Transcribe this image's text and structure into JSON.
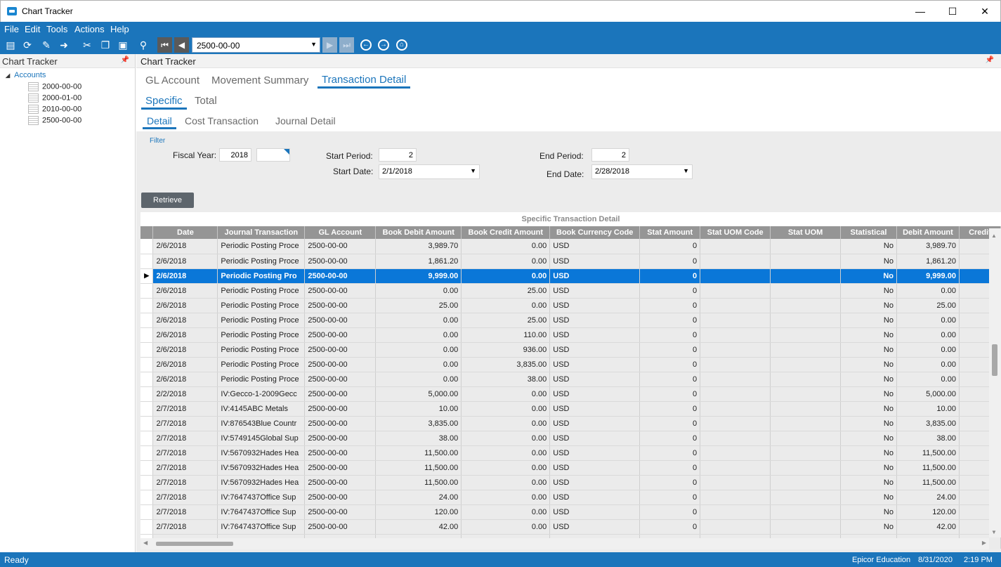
{
  "window": {
    "title": "Chart Tracker",
    "minimize": "—",
    "maximize": "☐",
    "close": "✕"
  },
  "menu": [
    "File",
    "Edit",
    "Tools",
    "Actions",
    "Help"
  ],
  "toolbar": {
    "combo_value": "2500-00-00"
  },
  "left_panel": {
    "title": "Chart Tracker",
    "root": "Accounts",
    "items": [
      "2000-00-00",
      "2000-01-00",
      "2010-00-00",
      "2500-00-00"
    ]
  },
  "right_panel": {
    "title": "Chart Tracker"
  },
  "tabs_main": [
    "GL Account",
    "Movement Summary",
    "Transaction Detail"
  ],
  "tabs_sub": [
    "Specific",
    "Total"
  ],
  "tabs_detail": [
    "Detail",
    "Cost Transaction",
    "Journal Detail"
  ],
  "filter": {
    "caption": "Filter",
    "fiscal_year_label": "Fiscal Year:",
    "fiscal_year": "2018",
    "start_period_label": "Start Period:",
    "start_period": "2",
    "start_date_label": "Start Date:",
    "start_date": "2/1/2018",
    "end_period_label": "End Period:",
    "end_period": "2",
    "end_date_label": "End Date:",
    "end_date": "2/28/2018"
  },
  "retrieve_label": "Retrieve",
  "grid": {
    "caption": "Specific Transaction Detail",
    "columns": [
      "Date",
      "Journal Transaction",
      "GL Account",
      "Book Debit Amount",
      "Book Credit Amount",
      "Book Currency Code",
      "Stat Amount",
      "Stat UOM Code",
      "Stat UOM",
      "Statistical",
      "Debit Amount",
      "Credit"
    ],
    "rows": [
      [
        "2/6/2018",
        "Periodic Posting Proce",
        "2500-00-00",
        "3,989.70",
        "0.00",
        "USD",
        "0",
        "",
        "",
        "No",
        "3,989.70",
        ""
      ],
      [
        "2/6/2018",
        "Periodic Posting Proce",
        "2500-00-00",
        "1,861.20",
        "0.00",
        "USD",
        "0",
        "",
        "",
        "No",
        "1,861.20",
        ""
      ],
      [
        "2/6/2018",
        "Periodic Posting Pro",
        "2500-00-00",
        "9,999.00",
        "0.00",
        "USD",
        "0",
        "",
        "",
        "No",
        "9,999.00",
        ""
      ],
      [
        "2/6/2018",
        "Periodic Posting Proce",
        "2500-00-00",
        "0.00",
        "25.00",
        "USD",
        "0",
        "",
        "",
        "No",
        "0.00",
        ""
      ],
      [
        "2/6/2018",
        "Periodic Posting Proce",
        "2500-00-00",
        "25.00",
        "0.00",
        "USD",
        "0",
        "",
        "",
        "No",
        "25.00",
        ""
      ],
      [
        "2/6/2018",
        "Periodic Posting Proce",
        "2500-00-00",
        "0.00",
        "25.00",
        "USD",
        "0",
        "",
        "",
        "No",
        "0.00",
        ""
      ],
      [
        "2/6/2018",
        "Periodic Posting Proce",
        "2500-00-00",
        "0.00",
        "110.00",
        "USD",
        "0",
        "",
        "",
        "No",
        "0.00",
        ""
      ],
      [
        "2/6/2018",
        "Periodic Posting Proce",
        "2500-00-00",
        "0.00",
        "936.00",
        "USD",
        "0",
        "",
        "",
        "No",
        "0.00",
        ""
      ],
      [
        "2/6/2018",
        "Periodic Posting Proce",
        "2500-00-00",
        "0.00",
        "3,835.00",
        "USD",
        "0",
        "",
        "",
        "No",
        "0.00",
        ""
      ],
      [
        "2/6/2018",
        "Periodic Posting Proce",
        "2500-00-00",
        "0.00",
        "38.00",
        "USD",
        "0",
        "",
        "",
        "No",
        "0.00",
        ""
      ],
      [
        "2/2/2018",
        "IV:Gecco-1-2009Gecc",
        "2500-00-00",
        "5,000.00",
        "0.00",
        "USD",
        "0",
        "",
        "",
        "No",
        "5,000.00",
        ""
      ],
      [
        "2/7/2018",
        "IV:4145ABC Metals",
        "2500-00-00",
        "10.00",
        "0.00",
        "USD",
        "0",
        "",
        "",
        "No",
        "10.00",
        ""
      ],
      [
        "2/7/2018",
        "IV:876543Blue Countr",
        "2500-00-00",
        "3,835.00",
        "0.00",
        "USD",
        "0",
        "",
        "",
        "No",
        "3,835.00",
        ""
      ],
      [
        "2/7/2018",
        "IV:5749145Global Sup",
        "2500-00-00",
        "38.00",
        "0.00",
        "USD",
        "0",
        "",
        "",
        "No",
        "38.00",
        ""
      ],
      [
        "2/7/2018",
        "IV:5670932Hades Hea",
        "2500-00-00",
        "11,500.00",
        "0.00",
        "USD",
        "0",
        "",
        "",
        "No",
        "11,500.00",
        ""
      ],
      [
        "2/7/2018",
        "IV:5670932Hades Hea",
        "2500-00-00",
        "11,500.00",
        "0.00",
        "USD",
        "0",
        "",
        "",
        "No",
        "11,500.00",
        ""
      ],
      [
        "2/7/2018",
        "IV:5670932Hades Hea",
        "2500-00-00",
        "11,500.00",
        "0.00",
        "USD",
        "0",
        "",
        "",
        "No",
        "11,500.00",
        ""
      ],
      [
        "2/7/2018",
        "IV:7647437Office Sup",
        "2500-00-00",
        "24.00",
        "0.00",
        "USD",
        "0",
        "",
        "",
        "No",
        "24.00",
        ""
      ],
      [
        "2/7/2018",
        "IV:7647437Office Sup",
        "2500-00-00",
        "120.00",
        "0.00",
        "USD",
        "0",
        "",
        "",
        "No",
        "120.00",
        ""
      ],
      [
        "2/7/2018",
        "IV:7647437Office Sup",
        "2500-00-00",
        "42.00",
        "0.00",
        "USD",
        "0",
        "",
        "",
        "No",
        "42.00",
        ""
      ]
    ],
    "selected_row": 2
  },
  "status": {
    "left": "Ready",
    "company": "Epicor Education",
    "date": "8/31/2020",
    "time": "2:19 PM"
  }
}
